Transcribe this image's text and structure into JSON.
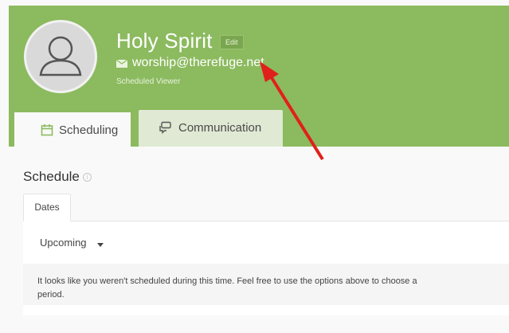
{
  "profile": {
    "name": "Holy Spirit",
    "edit_label": "Edit",
    "email": "worship@therefuge.net",
    "role": "Scheduled Viewer"
  },
  "tabs": [
    {
      "label": "Scheduling",
      "icon": "calendar-icon",
      "active": true
    },
    {
      "label": "Communication",
      "icon": "chat-icon",
      "active": false
    }
  ],
  "schedule": {
    "title": "Schedule",
    "info_icon": "info-icon",
    "subtabs": [
      "Dates"
    ],
    "filter_selected": "Upcoming",
    "empty_message": "It looks like you weren't scheduled during this time. Feel free to use the options above to choose a\nperiod."
  },
  "colors": {
    "header_green": "#8cba5f",
    "annotation_arrow": "#e0201b"
  }
}
